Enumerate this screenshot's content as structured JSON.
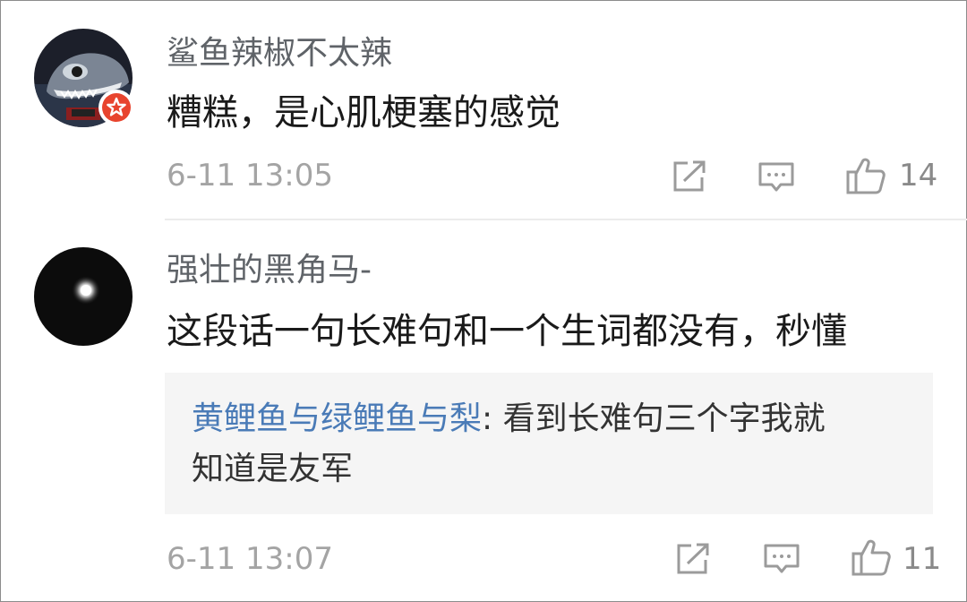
{
  "comments": [
    {
      "username": "鲨鱼辣椒不太辣",
      "text": "糟糕，是心肌梗塞的感觉",
      "timestamp": "6-11 13:05",
      "likes": "14",
      "avatar_icon": "shark-avatar",
      "badge_icon": "verified-star-badge-icon",
      "badge_color": "#e8442e"
    },
    {
      "username": "强壮的黑角马-",
      "text": "这段话一句长难句和一个生词都没有，秒懂",
      "reply": {
        "author": "黄鲤鱼与绿鲤鱼与梨",
        "separator": ": ",
        "text_line1": "看到长难句三个字我就",
        "text_line2": "知道是友军"
      },
      "timestamp": "6-11 13:07",
      "likes": "11",
      "avatar_icon": "moon-avatar"
    }
  ],
  "actions": {
    "repost_icon": "repost-icon",
    "comment_icon": "comment-icon",
    "like_icon": "thumbs-up-icon"
  },
  "colors": {
    "username": "#5f6368",
    "text": "#1a1a1a",
    "reply_author": "#4a7bb7",
    "reply_background": "#f5f5f5",
    "meta": "#a4a4a4"
  }
}
